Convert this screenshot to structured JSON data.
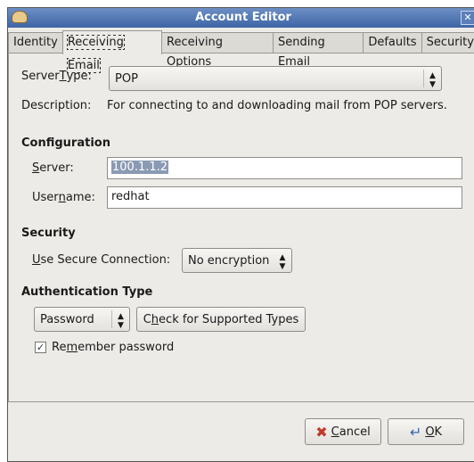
{
  "window": {
    "title": "Account Editor",
    "close": "✕"
  },
  "tabs": [
    {
      "label": "Identity"
    },
    {
      "label": "Receiving Email"
    },
    {
      "label": "Receiving Options"
    },
    {
      "label": "Sending Email"
    },
    {
      "label": "Defaults"
    },
    {
      "label": "Security"
    }
  ],
  "server_type": {
    "pre": "Server ",
    "key": "T",
    "post": "ype:",
    "value": "POP"
  },
  "description": {
    "label": "Description:",
    "text": "For connecting to and downloading mail from POP servers."
  },
  "configuration": {
    "heading": "Configuration",
    "server": {
      "pre": "",
      "key": "S",
      "post": "erver:",
      "value": "100.1.1.2"
    },
    "username": {
      "pre": "User",
      "key": "n",
      "post": "ame:",
      "value": "redhat"
    }
  },
  "security": {
    "heading": "Security",
    "label": {
      "pre": "",
      "key": "U",
      "post": "se Secure Connection:"
    },
    "value": "No encryption"
  },
  "auth": {
    "heading": "Authentication Type",
    "value": "Password",
    "check_button": {
      "pre": "C",
      "key": "h",
      "post": "eck for Supported Types"
    },
    "remember": {
      "pre": "Re",
      "key": "m",
      "post": "ember password",
      "checked": true
    }
  },
  "buttons": {
    "cancel": {
      "pre": "",
      "key": "C",
      "post": "ancel"
    },
    "ok": {
      "pre": "",
      "key": "O",
      "post": "K"
    }
  }
}
